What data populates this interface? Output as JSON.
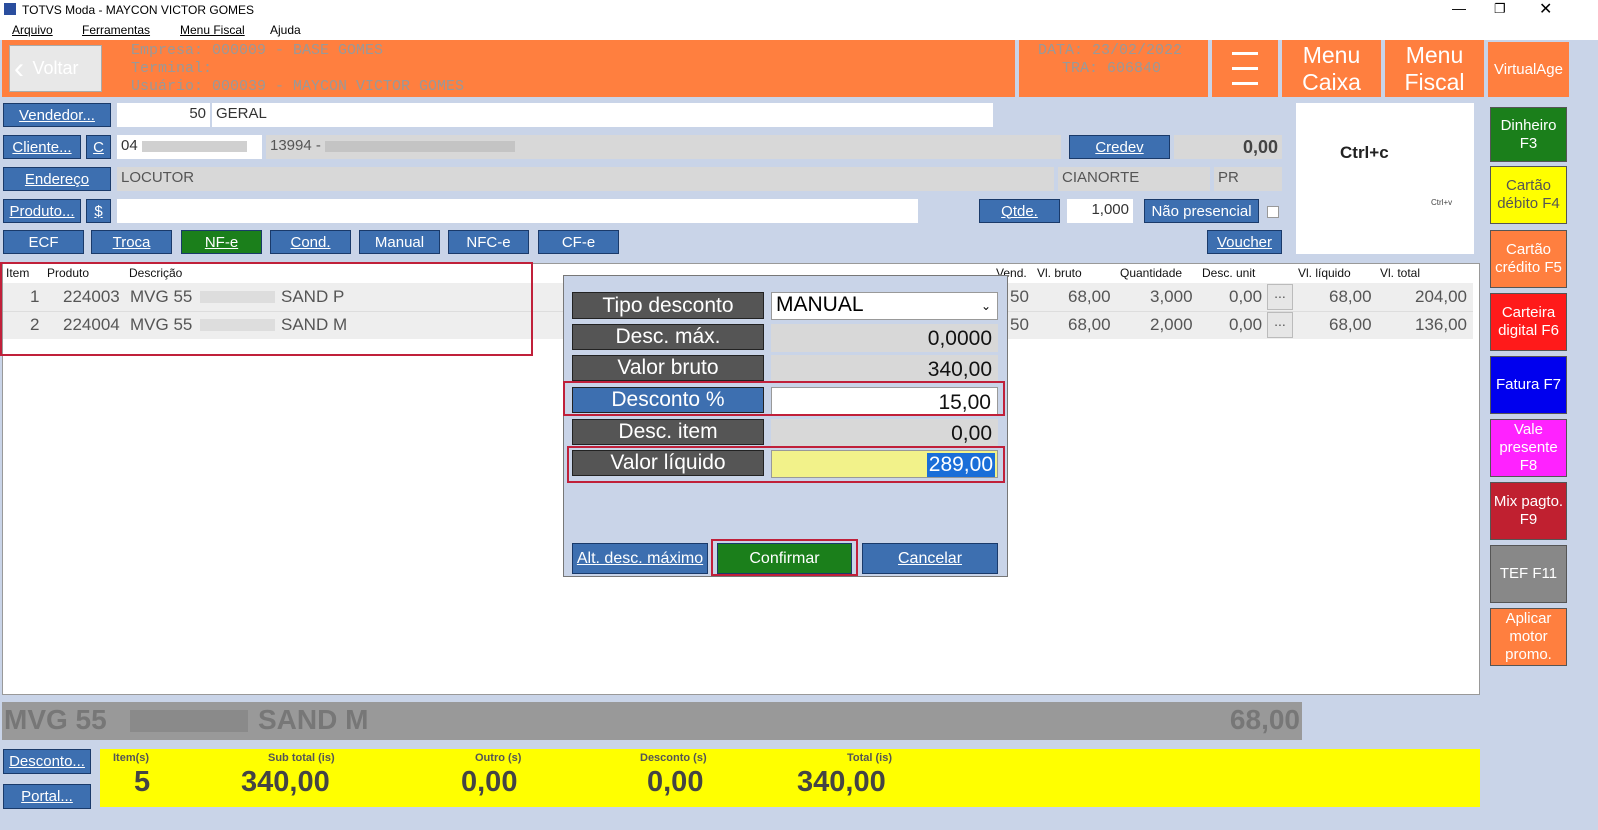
{
  "window": {
    "title": "TOTVS Moda - MAYCON VICTOR GOMES"
  },
  "menu": {
    "items": [
      "Arquivo",
      "Ferramentas",
      "Menu Fiscal",
      "Ajuda"
    ]
  },
  "header": {
    "back_label": "Voltar",
    "empresa": "Empresa: 000009 - BASE GOMES",
    "terminal": "Terminal:",
    "usuario": "Usuário: 000039 - MAYCON VICTOR GOMES",
    "data": "DATA: 23/02/2022",
    "tra": "TRA: 606840",
    "menu_caixa": "Menu Caixa",
    "menu_fiscal": "Menu Fiscal",
    "virtualage": "VirtualAge"
  },
  "form": {
    "vendedor_label": "Vendedor...",
    "vendedor_code": "50",
    "vendedor_name": "GERAL",
    "cliente_label": "Cliente...",
    "cliente_c": "C",
    "cliente_doc": "04",
    "cliente_code": "13994 -",
    "credev_label": "Credev",
    "credev_value": "0,00",
    "endereco_label": "Endereço",
    "endereco_value": "LOCUTOR",
    "cidade": "CIANORTE",
    "uf": "PR",
    "produto_label": "Produto...",
    "produto_dollar": "$",
    "qtde_label": "Qtde.",
    "qtde_value": "1,000",
    "nao_presencial": "Não presencial",
    "ctrlc": "Ctrl+c",
    "ctrlv": "Ctrl+v"
  },
  "toolbar": {
    "ecf": "ECF",
    "troca": "Troca",
    "nfe": "NF-e",
    "cond": "Cond.",
    "manual": "Manual",
    "nfce": "NFC-e",
    "cfe": "CF-e",
    "voucher": "Voucher"
  },
  "table": {
    "headers": {
      "item": "Item",
      "produto": "Produto",
      "descricao": "Descrição",
      "vend": "Vend.",
      "vl_bruto": "Vl. bruto",
      "quantidade": "Quantidade",
      "desc_unit": "Desc. unit",
      "vl_liquido": "Vl. líquido",
      "vl_total": "Vl. total"
    },
    "rows": [
      {
        "item": "1",
        "produto": "224003",
        "desc_a": "MVG 55",
        "desc_b": "SAND P",
        "vend": "50",
        "vl_bruto": "68,00",
        "quantidade": "3,000",
        "desc_unit": "0,00",
        "dots": "...",
        "vl_liquido": "68,00",
        "vl_total": "204,00"
      },
      {
        "item": "2",
        "produto": "224004",
        "desc_a": "MVG 55",
        "desc_b": "SAND M",
        "vend": "50",
        "vl_bruto": "68,00",
        "quantidade": "2,000",
        "desc_unit": "0,00",
        "dots": "...",
        "vl_liquido": "68,00",
        "vl_total": "136,00"
      }
    ]
  },
  "dialog": {
    "tipo_label": "Tipo desconto",
    "tipo_value": "MANUAL",
    "descmax_label": "Desc. máx.",
    "descmax_value": "0,0000",
    "valorbruto_label": "Valor bruto",
    "valorbruto_value": "340,00",
    "descpct_label": "Desconto %",
    "descpct_value": "15,00",
    "descitem_label": "Desc. item",
    "descitem_value": "0,00",
    "valorliq_label": "Valor líquido",
    "valorliq_value": "289,00",
    "alt_label": "Alt. desc. máximo",
    "confirmar_label": "Confirmar",
    "cancelar_label": "Cancelar"
  },
  "side": {
    "dinheiro": "Dinheiro F3",
    "debito": "Cartão débito F4",
    "credito": "Cartão crédito F5",
    "carteira": "Carteira digital F6",
    "fatura": "Fatura F7",
    "vale": "Vale presente F8",
    "mix": "Mix pagto. F9",
    "tef": "TEF F11",
    "aplicar": "Aplicar motor promo."
  },
  "current_item": {
    "desc_a": "MVG 55",
    "desc_b": "SAND M",
    "price": "68,00"
  },
  "bottom": {
    "desconto_label": "Desconto...",
    "portal_label": "Portal...",
    "itens_label": "Item(s)",
    "itens_value": "5",
    "subtotal_label": "Sub total (is)",
    "subtotal_value": "340,00",
    "outro_label": "Outro (s)",
    "outro_value": "0,00",
    "desconto_s_label": "Desconto (s)",
    "desconto_s_value": "0,00",
    "total_label": "Total (is)",
    "total_value": "340,00"
  },
  "colors": {
    "orange": "#ff7f3f",
    "yellow": "#ffff00",
    "blue_btn": "#3d6fb0"
  }
}
